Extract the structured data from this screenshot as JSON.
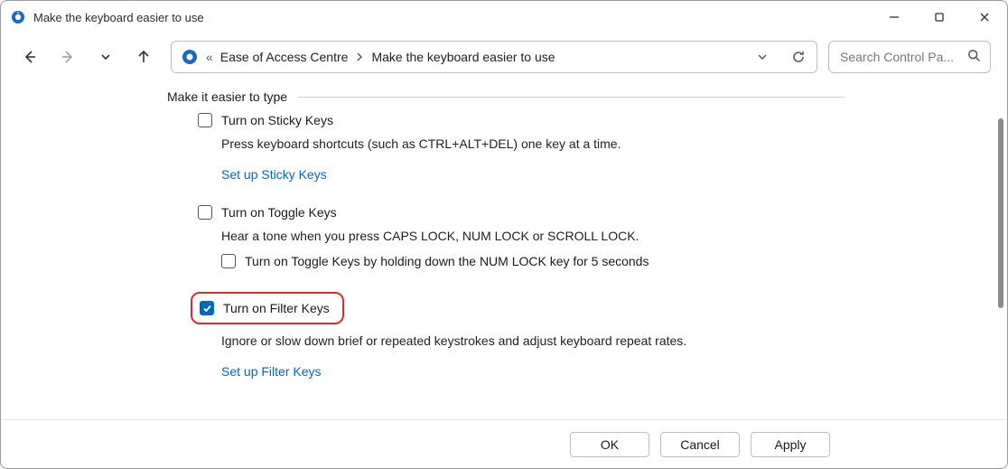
{
  "window": {
    "title": "Make the keyboard easier to use"
  },
  "breadcrumb": {
    "back_chevrons": "«",
    "seg1": "Ease of Access Centre",
    "seg2": "Make the keyboard easier to use"
  },
  "search": {
    "placeholder": "Search Control Pa..."
  },
  "section": {
    "title": "Make it easier to type"
  },
  "sticky": {
    "checkbox_label": "Turn on Sticky Keys",
    "checked": false,
    "desc": "Press keyboard shortcuts (such as CTRL+ALT+DEL) one key at a time.",
    "link": "Set up Sticky Keys"
  },
  "toggle": {
    "checkbox_label": "Turn on Toggle Keys",
    "checked": false,
    "desc": "Hear a tone when you press CAPS LOCK, NUM LOCK or SCROLL LOCK.",
    "sub_checkbox_label": "Turn on Toggle Keys by holding down the NUM LOCK key for 5 seconds",
    "sub_checked": false
  },
  "filter": {
    "checkbox_label": "Turn on Filter Keys",
    "checked": true,
    "desc": "Ignore or slow down brief or repeated keystrokes and adjust keyboard repeat rates.",
    "link": "Set up Filter Keys"
  },
  "buttons": {
    "ok": "OK",
    "cancel": "Cancel",
    "apply": "Apply"
  }
}
